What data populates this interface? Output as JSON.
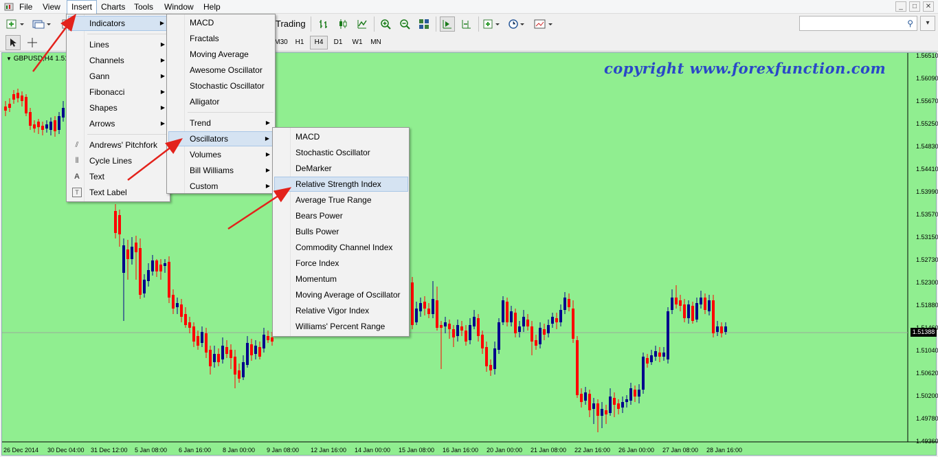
{
  "menubar": {
    "items": [
      "File",
      "View",
      "Insert",
      "Charts",
      "Tools",
      "Window",
      "Help"
    ],
    "active": "Insert",
    "window_controls": [
      "_",
      "□",
      "✕"
    ]
  },
  "toolbar": {
    "trading_label": "Trading",
    "timeframes": [
      "M30",
      "H1",
      "H4",
      "D1",
      "W1",
      "MN"
    ],
    "active_timeframe": "H4",
    "search_placeholder": ""
  },
  "chart": {
    "title": "GBPUSD,H4  1.51",
    "watermark": "copyright www.forexfunction.com",
    "background": "#90ee90",
    "bull_color": "#00008b",
    "bear_color": "#ff0000",
    "current_price": "1.51388",
    "price_axis": [
      "1.56510",
      "1.56090",
      "1.55670",
      "1.55250",
      "1.54830",
      "1.54410",
      "1.53990",
      "1.53570",
      "1.53150",
      "1.52730",
      "1.52300",
      "1.51880",
      "1.51460",
      "1.51040",
      "1.50620",
      "1.50200",
      "1.49780",
      "1.49360"
    ],
    "time_axis": [
      "26 Dec 2014",
      "30 Dec 04:00",
      "31 Dec 12:00",
      "5 Jan 08:00",
      "6 Jan 16:00",
      "8 Jan 00:00",
      "9 Jan 08:00",
      "12 Jan 16:00",
      "14 Jan 00:00",
      "15 Jan 08:00",
      "16 Jan 16:00",
      "20 Jan 00:00",
      "21 Jan 08:00",
      "22 Jan 16:00",
      "26 Jan 00:00",
      "27 Jan 08:00",
      "28 Jan 16:00"
    ]
  },
  "insert_menu": {
    "items": [
      {
        "label": "Indicators",
        "submenu": true,
        "highlighted": true
      },
      {
        "label": "Lines",
        "submenu": true
      },
      {
        "label": "Channels",
        "submenu": true
      },
      {
        "label": "Gann",
        "submenu": true
      },
      {
        "label": "Fibonacci",
        "submenu": true
      },
      {
        "label": "Shapes",
        "submenu": true
      },
      {
        "label": "Arrows",
        "submenu": true
      },
      {
        "label": "Andrews' Pitchfork",
        "icon": "pitchfork-icon"
      },
      {
        "label": "Cycle Lines",
        "icon": "cycle-lines-icon"
      },
      {
        "label": "Text",
        "icon": "text-icon"
      },
      {
        "label": "Text Label",
        "icon": "text-label-icon"
      }
    ]
  },
  "indicators_menu": {
    "items": [
      {
        "label": "MACD"
      },
      {
        "label": "Fractals"
      },
      {
        "label": "Moving Average"
      },
      {
        "label": "Awesome Oscillator"
      },
      {
        "label": "Stochastic Oscillator"
      },
      {
        "label": "Alligator"
      },
      {
        "label": "Trend",
        "submenu": true
      },
      {
        "label": "Oscillators",
        "submenu": true,
        "highlighted": true
      },
      {
        "label": "Volumes",
        "submenu": true
      },
      {
        "label": "Bill Williams",
        "submenu": true
      },
      {
        "label": "Custom",
        "submenu": true
      }
    ]
  },
  "oscillators_menu": {
    "items": [
      {
        "label": "MACD"
      },
      {
        "label": "Stochastic Oscillator"
      },
      {
        "label": "DeMarker"
      },
      {
        "label": "Relative Strength Index",
        "highlighted": true
      },
      {
        "label": "Average True Range"
      },
      {
        "label": "Bears Power"
      },
      {
        "label": "Bulls Power"
      },
      {
        "label": "Commodity Channel Index"
      },
      {
        "label": "Force Index"
      },
      {
        "label": "Momentum"
      },
      {
        "label": "Moving Average of Oscillator"
      },
      {
        "label": "Relative Vigor Index"
      },
      {
        "label": "Williams' Percent Range"
      }
    ]
  }
}
